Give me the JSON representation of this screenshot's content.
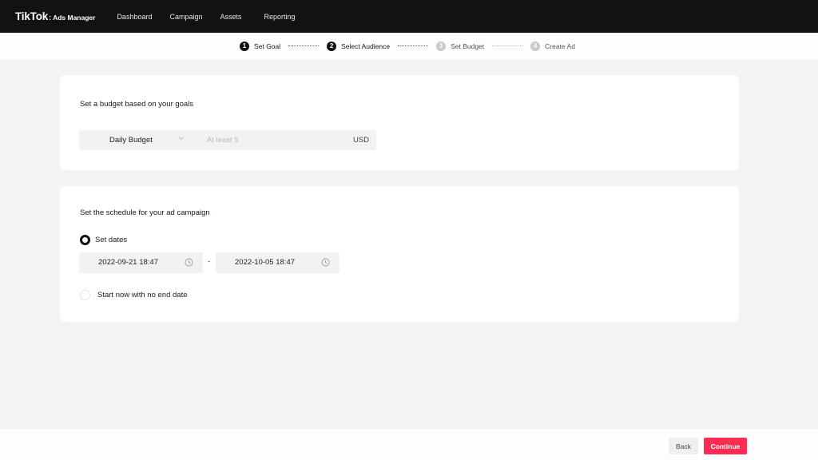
{
  "header": {
    "logo_main": "TikTok",
    "logo_sep": ":",
    "logo_sub": "Ads Manager",
    "nav": [
      "Dashboard",
      "Campaign",
      "Assets",
      "Reporting"
    ]
  },
  "steps": [
    {
      "num": "1",
      "label": "Set Goal",
      "state": "done"
    },
    {
      "num": "2",
      "label": "Select Audience",
      "state": "done"
    },
    {
      "num": "3",
      "label": "Set Budget",
      "state": "todo"
    },
    {
      "num": "4",
      "label": "Create Ad",
      "state": "todo"
    }
  ],
  "budget": {
    "title": "Set a budget based on your goals",
    "type": "Daily Budget",
    "amount_value": "",
    "amount_placeholder": "At least 5",
    "currency": "USD"
  },
  "schedule": {
    "title": "Set the schedule for your ad campaign",
    "option_set_dates": "Set dates",
    "option_no_end": "Start now with no end date",
    "selected": "set_dates",
    "start": "2022-09-21 18:47",
    "separator": "-",
    "end": "2022-10-05 18:47"
  },
  "footer": {
    "back_label": "Back",
    "continue_label": "Continue"
  },
  "colors": {
    "accent": "#fe2c55",
    "topbar": "#121212"
  }
}
